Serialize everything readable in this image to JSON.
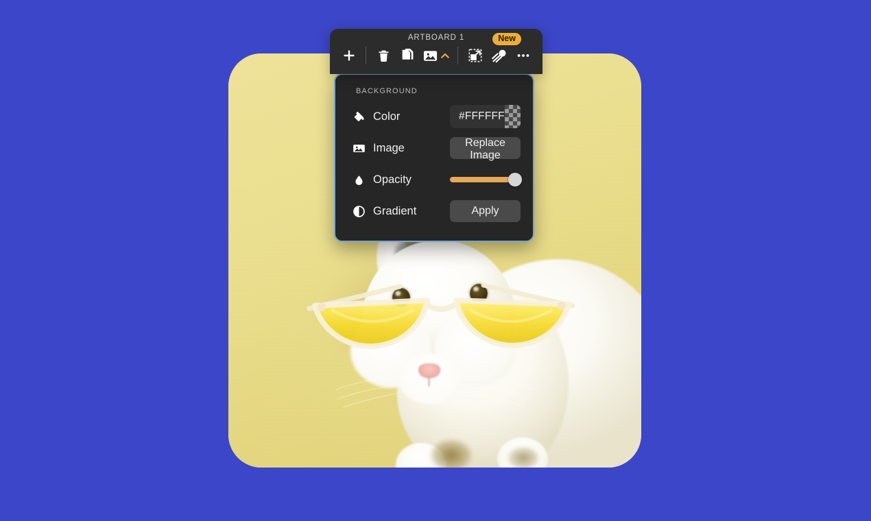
{
  "canvas": {
    "background_color": "#3c46c8"
  },
  "artboard": {
    "name": "ARTBOARD 1",
    "background_color": "#ece08f",
    "image_subject": "white rabbit wearing yellow half-moon sunglasses"
  },
  "toolbar": {
    "title": "ARTBOARD 1",
    "buttons": [
      {
        "name": "add",
        "icon": "plus-icon",
        "label": "Add"
      },
      {
        "name": "delete",
        "icon": "trash-icon",
        "label": "Delete"
      },
      {
        "name": "duplicate",
        "icon": "copy-icon",
        "label": "Duplicate"
      },
      {
        "name": "background",
        "icon": "image-icon",
        "label": "Background",
        "active": true,
        "chevron": "chevron-up-icon"
      },
      {
        "name": "resize",
        "icon": "resize-icon",
        "label": "Resize"
      },
      {
        "name": "magic",
        "icon": "comet-icon",
        "label": "Magic",
        "badge": "New"
      },
      {
        "name": "more",
        "icon": "ellipsis-icon",
        "label": "More"
      }
    ],
    "badge_label": "New",
    "accent_color": "#e9a23b"
  },
  "panel": {
    "heading": "BACKGROUND",
    "border_color": "#7aa5c8",
    "rows": [
      {
        "id": "color",
        "icon": "paint-bucket-icon",
        "label": "Color",
        "control": "color-field",
        "value": "#FFFFFF",
        "swatch": "transparent-checkerboard"
      },
      {
        "id": "image",
        "icon": "image-icon",
        "label": "Image",
        "control": "button",
        "value": "Replace Image"
      },
      {
        "id": "opacity",
        "icon": "droplet-icon",
        "label": "Opacity",
        "control": "slider",
        "value": "100",
        "slider_color": "#e8a857"
      },
      {
        "id": "gradient",
        "icon": "contrast-icon",
        "label": "Gradient",
        "control": "button",
        "value": "Apply"
      }
    ]
  }
}
